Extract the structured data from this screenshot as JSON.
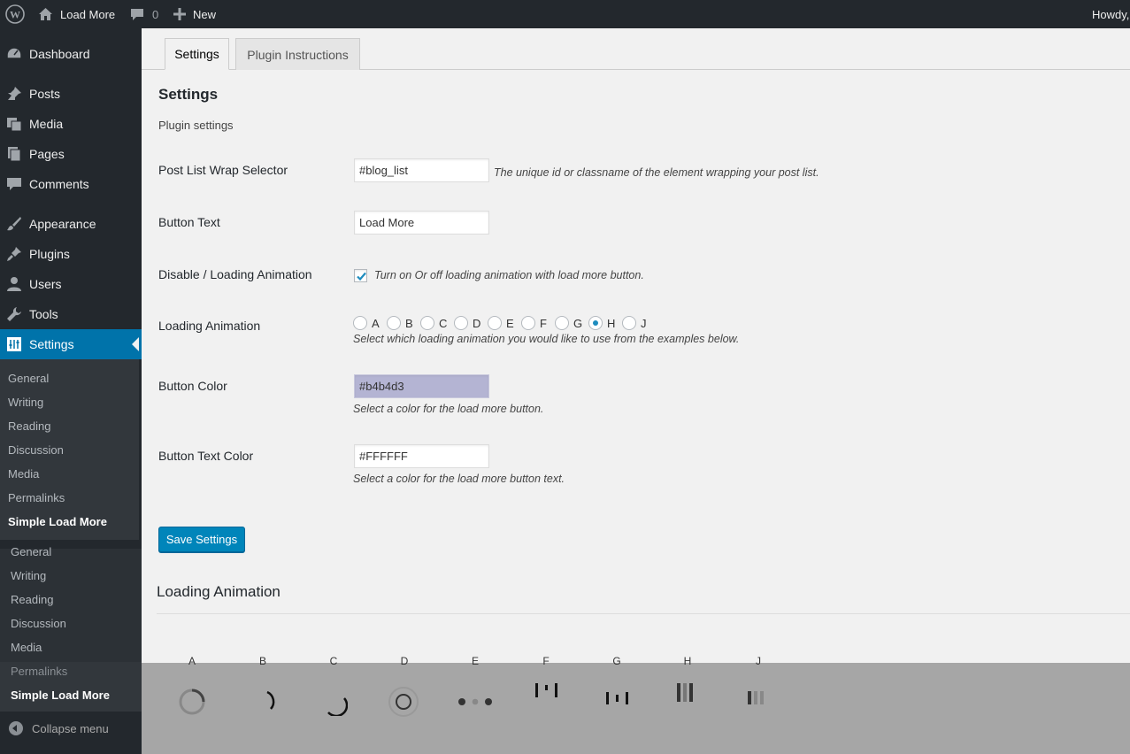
{
  "adminbar": {
    "site_name": "Load More",
    "comments_count": "0",
    "new_label": "New",
    "howdy": "Howdy,"
  },
  "sidebar": {
    "items": [
      {
        "label": "Dashboard",
        "icon": "dashboard-icon"
      },
      {
        "label": "Posts",
        "icon": "pin-icon"
      },
      {
        "label": "Media",
        "icon": "media-icon"
      },
      {
        "label": "Pages",
        "icon": "pages-icon"
      },
      {
        "label": "Comments",
        "icon": "comments-icon"
      },
      {
        "label": "Appearance",
        "icon": "brush-icon"
      },
      {
        "label": "Plugins",
        "icon": "plugin-icon"
      },
      {
        "label": "Users",
        "icon": "user-icon"
      },
      {
        "label": "Tools",
        "icon": "wrench-icon"
      },
      {
        "label": "Settings",
        "icon": "settings-icon"
      }
    ],
    "submenu": [
      "General",
      "Writing",
      "Reading",
      "Discussion",
      "Media",
      "Permalinks",
      "Simple Load More"
    ],
    "submenu_repeat": [
      "General",
      "Writing",
      "Reading",
      "Discussion",
      "Media",
      "Permalinks",
      "Simple Load More"
    ],
    "collapse_label": "Collapse menu"
  },
  "tabs": [
    "Settings",
    "Plugin Instructions"
  ],
  "settings": {
    "heading": "Settings",
    "description": "Plugin settings",
    "fields": {
      "wrap_selector": {
        "label": "Post List Wrap Selector",
        "value": "#blog_list",
        "hint": "The unique id or classname of the element wrapping your post list."
      },
      "button_text": {
        "label": "Button Text",
        "value": "Load More"
      },
      "animation_toggle": {
        "label": "Disable / Loading Animation",
        "checked": true,
        "hint": "Turn on Or off loading animation with load more button."
      },
      "loading_animation": {
        "label": "Loading Animation",
        "options": [
          "A",
          "B",
          "C",
          "D",
          "E",
          "F",
          "G",
          "H",
          "J"
        ],
        "selected": "H",
        "hint": "Select which loading animation you would like to use from the examples below."
      },
      "button_color": {
        "label": "Button Color",
        "value": "#b4b4d3",
        "hint": "Select a color for the load more button.",
        "color": "#b4b4d3"
      },
      "button_text_color": {
        "label": "Button Text Color",
        "value": "#FFFFFF",
        "hint": "Select a color for the load more button text."
      }
    },
    "save_label": "Save Settings"
  },
  "loading_section": {
    "heading": "Loading Animation",
    "labels": [
      "A",
      "B",
      "C",
      "D",
      "E",
      "F",
      "G",
      "H",
      "J"
    ]
  },
  "colors": {
    "adminbar_bg": "#23282d",
    "accent": "#0073aa",
    "button": "#0085ba"
  }
}
